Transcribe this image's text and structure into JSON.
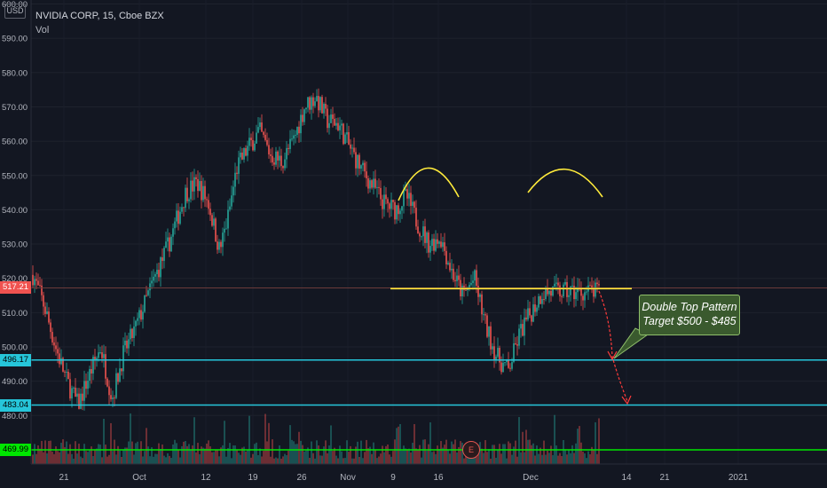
{
  "header": {
    "symbol_title": "NVIDIA CORP, 15, Cboe BZX",
    "indicator": "Vol",
    "currency": "USD"
  },
  "price_axis": {
    "ticks": [
      "600.00",
      "590.00",
      "580.00",
      "570.00",
      "560.00",
      "550.00",
      "540.00",
      "530.00",
      "520.00",
      "510.00",
      "500.00",
      "490.00",
      "480.00"
    ],
    "tick_values": [
      600,
      590,
      580,
      570,
      560,
      550,
      540,
      530,
      520,
      510,
      500,
      490,
      480
    ]
  },
  "time_axis": {
    "labels": [
      "21",
      "Oct",
      "12",
      "19",
      "26",
      "Nov",
      "9",
      "16",
      "Dec",
      "14",
      "21",
      "2021"
    ]
  },
  "price_tags": [
    {
      "label": "517.21",
      "value": 517.21,
      "color": "#f05350"
    },
    {
      "label": "496.17",
      "value": 496.17,
      "color": "#26c6da"
    },
    {
      "label": "483.04",
      "value": 483.04,
      "color": "#26c6da"
    },
    {
      "label": "469.99",
      "value": 469.99,
      "color": "#00e600"
    }
  ],
  "annotation": {
    "line1": "Double Top Pattern",
    "line2": "Target $500 - $485"
  },
  "earnings_badge": "E",
  "chart_data": {
    "type": "candlestick",
    "title": "NVIDIA CORP, 15, Cboe BZX",
    "ylim": [
      476,
      602
    ],
    "close_path": [
      [
        0,
        521
      ],
      [
        0.02,
        512
      ],
      [
        0.04,
        500
      ],
      [
        0.06,
        490
      ],
      [
        0.08,
        483
      ],
      [
        0.1,
        492
      ],
      [
        0.12,
        500
      ],
      [
        0.14,
        485
      ],
      [
        0.16,
        498
      ],
      [
        0.18,
        505
      ],
      [
        0.21,
        518
      ],
      [
        0.24,
        530
      ],
      [
        0.27,
        545
      ],
      [
        0.29,
        548
      ],
      [
        0.31,
        542
      ],
      [
        0.33,
        528
      ],
      [
        0.345,
        538
      ],
      [
        0.36,
        552
      ],
      [
        0.38,
        558
      ],
      [
        0.4,
        563
      ],
      [
        0.42,
        556
      ],
      [
        0.44,
        554
      ],
      [
        0.46,
        560
      ],
      [
        0.48,
        570
      ],
      [
        0.5,
        573
      ],
      [
        0.52,
        566
      ],
      [
        0.54,
        565
      ],
      [
        0.56,
        558
      ],
      [
        0.58,
        552
      ],
      [
        0.6,
        547
      ],
      [
        0.62,
        542
      ],
      [
        0.64,
        540
      ],
      [
        0.66,
        544
      ],
      [
        0.68,
        536
      ],
      [
        0.7,
        530
      ],
      [
        0.72,
        532
      ],
      [
        0.74,
        522
      ],
      [
        0.76,
        515
      ],
      [
        0.78,
        520
      ],
      [
        0.8,
        506
      ],
      [
        0.82,
        497
      ],
      [
        0.84,
        493
      ],
      [
        0.86,
        504
      ],
      [
        0.88,
        510
      ],
      [
        0.9,
        516
      ]
    ],
    "lines": [
      {
        "label": "517.21",
        "value": 517.21
      },
      {
        "label": "496.17",
        "value": 496.17
      },
      {
        "label": "483.04",
        "value": 483.04
      },
      {
        "label": "469.99",
        "value": 469.99
      }
    ],
    "neckline": 517.0,
    "pattern": "Double Top",
    "target": "Target $500 - $485"
  }
}
